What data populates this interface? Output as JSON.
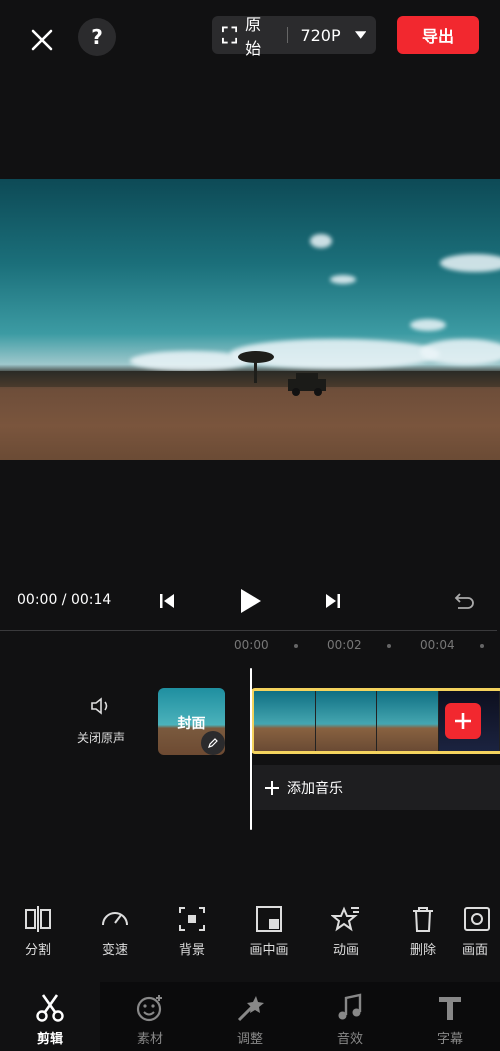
{
  "topbar": {
    "ratio_label": "原始",
    "resolution_label": "720P",
    "export_label": "导出",
    "help_label": "?"
  },
  "playback": {
    "time_display": "00:00 / 00:14"
  },
  "timeline": {
    "ruler": [
      "00:00",
      "00:02",
      "00:04"
    ],
    "mute_label": "关闭原声",
    "cover_label": "封面",
    "add_music_label": "添加音乐"
  },
  "toolbar": {
    "items": [
      {
        "label": "分割",
        "icon": "split-icon"
      },
      {
        "label": "变速",
        "icon": "speed-icon"
      },
      {
        "label": "背景",
        "icon": "background-icon"
      },
      {
        "label": "画中画",
        "icon": "pip-icon"
      },
      {
        "label": "动画",
        "icon": "animation-icon"
      },
      {
        "label": "删除",
        "icon": "delete-icon"
      },
      {
        "label": "画面",
        "icon": "frame-icon"
      }
    ]
  },
  "tabs": {
    "items": [
      {
        "label": "剪辑",
        "icon": "scissors-icon",
        "active": true
      },
      {
        "label": "素材",
        "icon": "sticker-icon",
        "active": false
      },
      {
        "label": "调整",
        "icon": "adjust-icon",
        "active": false
      },
      {
        "label": "音效",
        "icon": "music-note-icon",
        "active": false
      },
      {
        "label": "字幕",
        "icon": "text-icon",
        "active": false
      }
    ]
  },
  "colors": {
    "accent": "#f2282f",
    "clip_border": "#f4d35e",
    "background": "#111112"
  }
}
